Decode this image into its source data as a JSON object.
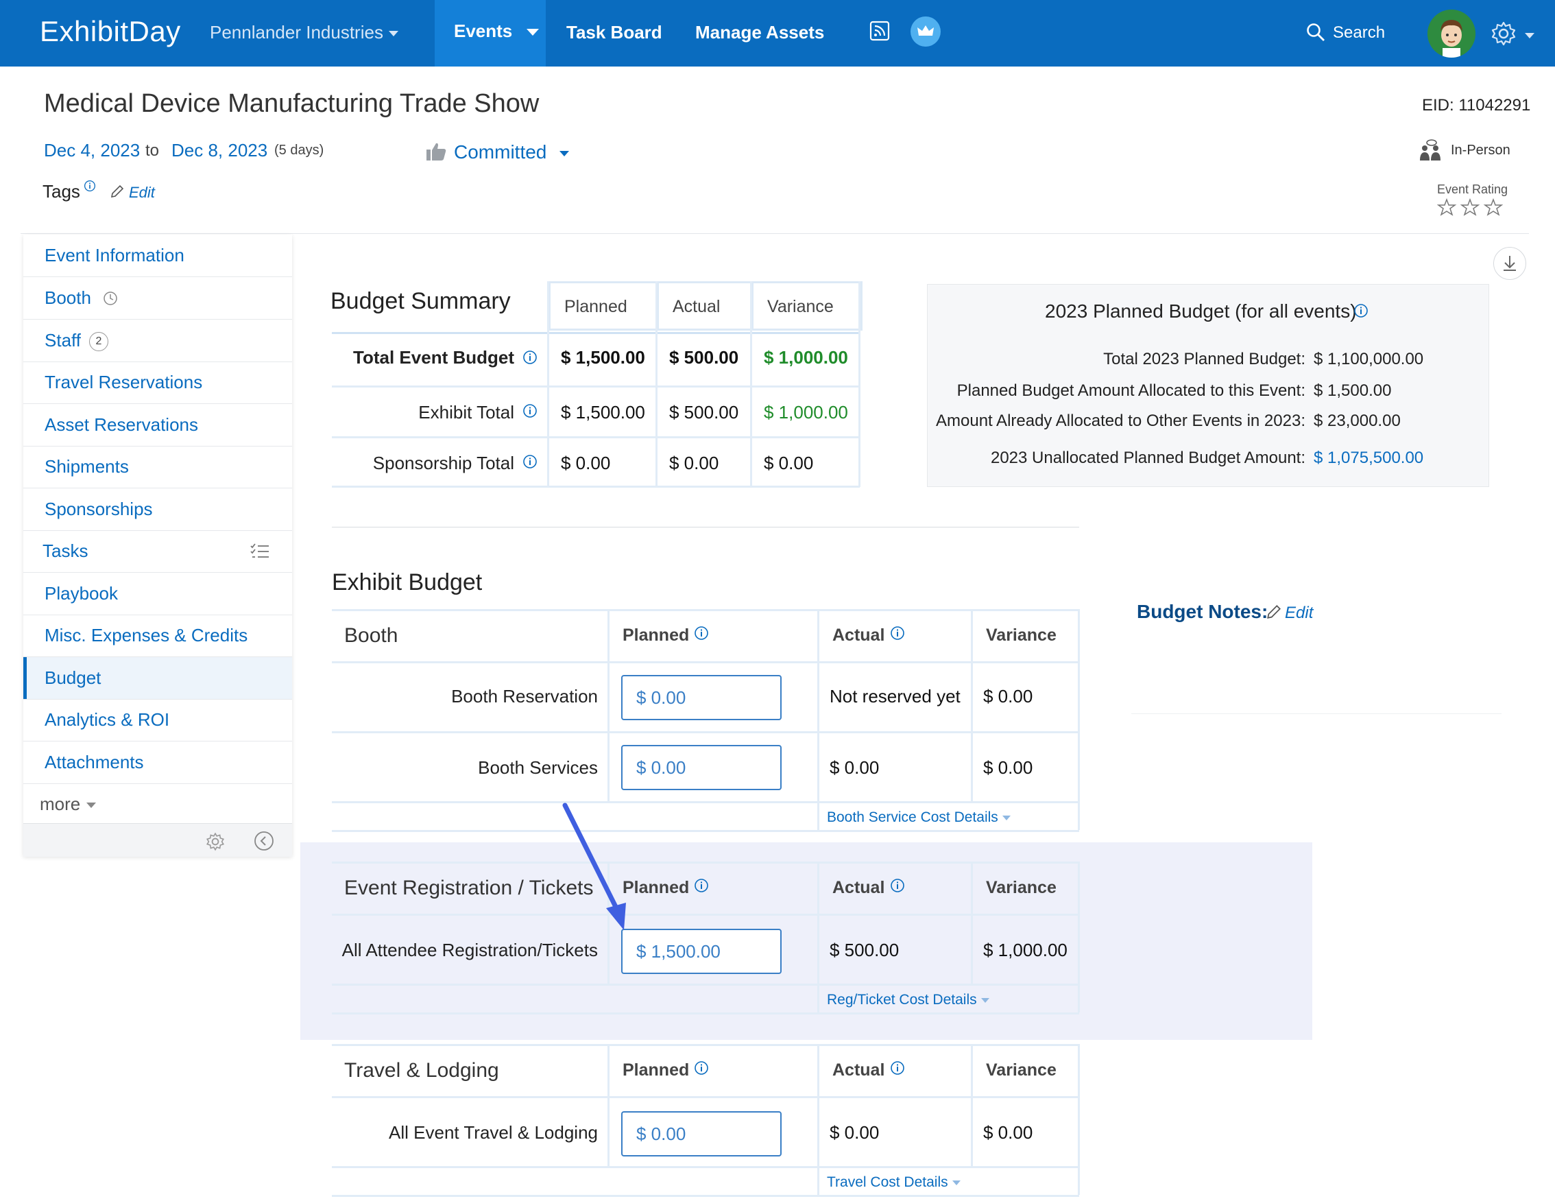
{
  "nav": {
    "logo": "ExhibitDay",
    "org": "Pennlander Industries",
    "tabs": {
      "events": "Events",
      "task_board": "Task Board",
      "manage_assets": "Manage Assets"
    },
    "search": "Search",
    "brand_color": "#0a6cbf"
  },
  "event": {
    "title": "Medical Device Manufacturing Trade Show",
    "eid": "EID: 11042291",
    "start": "Dec 4, 2023",
    "to": "to",
    "end": "Dec 8, 2023",
    "days": "(5 days)",
    "status": "Committed",
    "format": "In-Person",
    "tags_label": "Tags",
    "edit": "Edit",
    "rating_label": "Event Rating",
    "rating": 0
  },
  "sidebar": {
    "items": [
      {
        "label": "Event Information"
      },
      {
        "label": "Booth"
      },
      {
        "label": "Staff",
        "badge": "2"
      },
      {
        "label": "Travel Reservations"
      },
      {
        "label": "Asset Reservations"
      },
      {
        "label": "Shipments"
      },
      {
        "label": "Sponsorships"
      },
      {
        "label": "Tasks"
      },
      {
        "label": "Playbook"
      },
      {
        "label": "Misc. Expenses & Credits"
      },
      {
        "label": "Budget"
      },
      {
        "label": "Analytics & ROI"
      },
      {
        "label": "Attachments"
      }
    ],
    "more": "more"
  },
  "summary": {
    "title": "Budget Summary",
    "headers": [
      "Planned",
      "Actual",
      "Variance"
    ],
    "rows": [
      {
        "label": "Total Event Budget",
        "planned": "$ 1,500.00",
        "actual": "$ 500.00",
        "variance": "$ 1,000.00"
      },
      {
        "label": "Exhibit Total",
        "planned": "$ 1,500.00",
        "actual": "$ 500.00",
        "variance": "$ 1,000.00"
      },
      {
        "label": "Sponsorship Total",
        "planned": "$ 0.00",
        "actual": "$ 0.00",
        "variance": "$ 0.00"
      }
    ]
  },
  "planned_budget": {
    "title": "2023 Planned Budget (for all events)",
    "rows": [
      {
        "label": "Total 2023 Planned Budget:",
        "value": "$ 1,100,000.00"
      },
      {
        "label": "Planned Budget Amount Allocated to this Event:",
        "value": "$ 1,500.00"
      },
      {
        "label": "Amount Already Allocated to Other Events in 2023:",
        "value": "$ 23,000.00"
      },
      {
        "label": "2023 Unallocated Planned Budget Amount:",
        "value": "$ 1,075,500.00"
      }
    ]
  },
  "exhibit": {
    "title": "Exhibit Budget",
    "notes_label": "Budget Notes:",
    "notes_edit": "Edit",
    "col_planned": "Planned",
    "col_actual": "Actual",
    "col_variance": "Variance",
    "booth": {
      "title": "Booth",
      "rows": [
        {
          "label": "Booth Reservation",
          "planned": "$ 0.00",
          "actual": "Not reserved yet",
          "variance": "$ 0.00"
        },
        {
          "label": "Booth Services",
          "planned": "$ 0.00",
          "actual": "$ 0.00",
          "variance": "$ 0.00"
        }
      ],
      "details": "Booth Service Cost Details"
    },
    "registration": {
      "title": "Event Registration / Tickets",
      "rows": [
        {
          "label": "All Attendee Registration/Tickets",
          "planned": "$ 1,500.00",
          "actual": "$ 500.00",
          "variance": "$ 1,000.00"
        }
      ],
      "details": "Reg/Ticket Cost Details"
    },
    "travel": {
      "title": "Travel & Lodging",
      "rows": [
        {
          "label": "All Event Travel & Lodging",
          "planned": "$ 0.00",
          "actual": "$ 0.00",
          "variance": "$ 0.00"
        }
      ],
      "details": "Travel Cost Details"
    }
  }
}
